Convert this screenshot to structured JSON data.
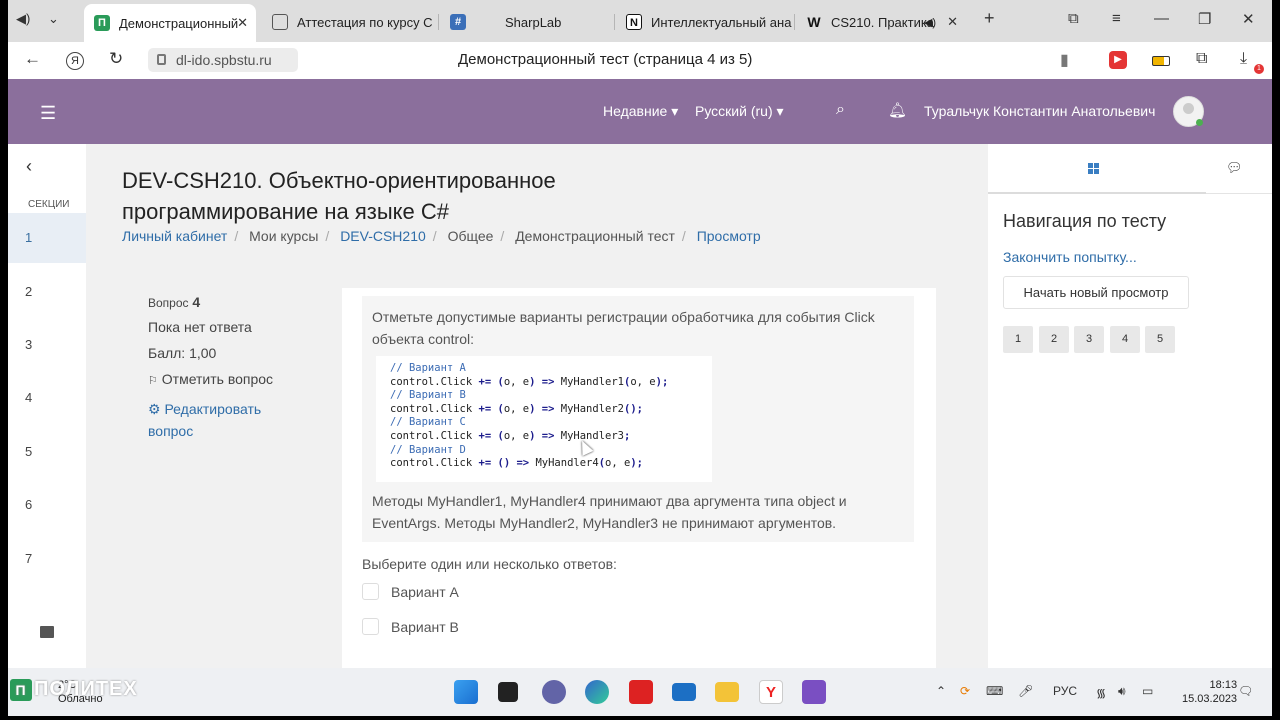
{
  "browser": {
    "tabs": [
      {
        "title": "Демонстрационный",
        "active": true,
        "color": "#2a9b59",
        "glyph": "П"
      },
      {
        "title": "Аттестация по курсу С",
        "active": false,
        "color": "#555555",
        "glyph": "▢"
      },
      {
        "title": "SharpLab",
        "active": false,
        "color": "#3b6fb8",
        "glyph": "#"
      },
      {
        "title": "Интеллектуальный ана",
        "active": false,
        "color": "#111111",
        "glyph": "N"
      },
      {
        "title": "CS210. Практика",
        "active": false,
        "color": "#ffffff",
        "glyph": "W"
      }
    ],
    "url": "dl-ido.spbstu.ru",
    "page_title": "Демонстрационный тест (страница 4 из 5)"
  },
  "header": {
    "recent": "Недавние",
    "language": "Русский (ru)",
    "user": "Туральчук Константин Анатольевич"
  },
  "sections_nav": {
    "caption": "СЕКЦИИ",
    "items": [
      "1",
      "2",
      "3",
      "4",
      "5",
      "6",
      "7"
    ],
    "selected": "1"
  },
  "course": {
    "title": "DEV-CSH210. Объектно-ориентированное программирование на языке C#",
    "breadcrumb": [
      "Личный кабинет",
      "Мои курсы",
      "DEV-CSH210",
      "Общее",
      "Демонстрационный тест",
      "Просмотр"
    ]
  },
  "question": {
    "label": "Вопрос",
    "number": "4",
    "state": "Пока нет ответа",
    "grade": "Балл: 1,00",
    "flag": "Отметить вопрос",
    "edit": "Редактировать вопрос",
    "text": "Отметьте допустимые варианты регистрации обработчика для события Click объекта control:",
    "code": [
      {
        "kind": "comment",
        "text": "// Вариант A"
      },
      {
        "kind": "code",
        "text": "control.Click += (o, e) => MyHandler1(o, e);"
      },
      {
        "kind": "comment",
        "text": "// Вариант B"
      },
      {
        "kind": "code",
        "text": "control.Click += (o, e) => MyHandler2();"
      },
      {
        "kind": "comment",
        "text": "// Вариант C"
      },
      {
        "kind": "code",
        "text": "control.Click += (o, e) => MyHandler3;"
      },
      {
        "kind": "comment",
        "text": "// Вариант D"
      },
      {
        "kind": "code",
        "text": "control.Click += () => MyHandler4(o, e);"
      }
    ],
    "note": "Методы MyHandler1, MyHandler4 принимают два аргумента типа object и EventArgs. Методы MyHandler2, MyHandler3 не принимают аргументов.",
    "prompt": "Выберите один или несколько ответов:",
    "options": [
      "Вариант A",
      "Вариант B"
    ]
  },
  "quiz_nav": {
    "title": "Навигация по тесту",
    "finish": "Закончить попытку...",
    "new_preview": "Начать новый просмотр",
    "pages": [
      "1",
      "2",
      "3",
      "4",
      "5"
    ]
  },
  "taskbar": {
    "temp": "2°C",
    "weather": "Облачно",
    "brand": "ПОЛИТЕХ",
    "lang": "РУС",
    "time": "18:13",
    "date": "15.03.2023"
  }
}
